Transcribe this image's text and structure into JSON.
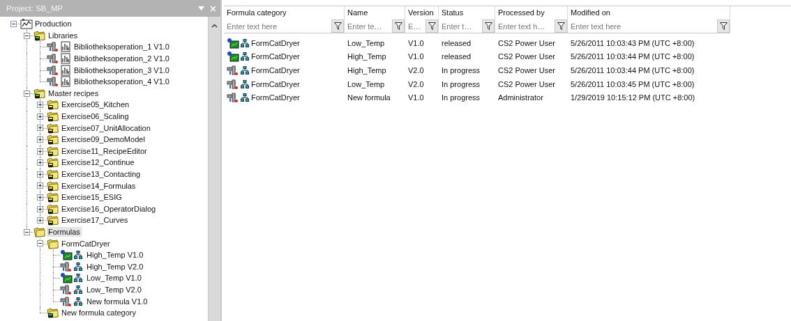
{
  "panel": {
    "title": "Project: SB_MP"
  },
  "tree": [
    {
      "label": "Production",
      "kind": "plant",
      "expanded": true,
      "selected": false,
      "children": [
        {
          "label": "Libraries",
          "kind": "library-folder",
          "expanded": true,
          "selected": false,
          "children": [
            {
              "label": "Bibliotheksoperation_1 V1.0",
              "kind": "library-operation",
              "selected": false
            },
            {
              "label": "Bibliotheksoperation_2 V1.0",
              "kind": "library-operation",
              "selected": false
            },
            {
              "label": "Bibliotheksoperation_3 V1.0",
              "kind": "library-operation",
              "selected": false
            },
            {
              "label": "Bibliotheksoperation_4 V1.0",
              "kind": "library-operation",
              "selected": false
            }
          ]
        },
        {
          "label": "Master recipes",
          "kind": "library-folder",
          "expanded": true,
          "selected": false,
          "children": [
            {
              "label": "Exercise05_Kitchen",
              "kind": "recipe-folder",
              "expanded": false,
              "selected": false
            },
            {
              "label": "Exercise06_Scaling",
              "kind": "recipe-folder",
              "expanded": false,
              "selected": false
            },
            {
              "label": "Exercise07_UnitAllocation",
              "kind": "recipe-folder",
              "expanded": false,
              "selected": false
            },
            {
              "label": "Exercise09_DemoModel",
              "kind": "recipe-folder",
              "expanded": false,
              "selected": false
            },
            {
              "label": "Exercise11_RecipeEditor",
              "kind": "recipe-folder",
              "expanded": false,
              "selected": false
            },
            {
              "label": "Exercise12_Continue",
              "kind": "recipe-folder",
              "expanded": false,
              "selected": false
            },
            {
              "label": "Exercise13_Contacting",
              "kind": "recipe-folder",
              "expanded": false,
              "selected": false
            },
            {
              "label": "Exercise14_Formulas",
              "kind": "recipe-folder",
              "expanded": false,
              "selected": false
            },
            {
              "label": "Exercise15_ESIG",
              "kind": "recipe-folder",
              "expanded": false,
              "selected": false
            },
            {
              "label": "Exercise16_OperatorDialog",
              "kind": "recipe-folder",
              "expanded": false,
              "selected": false
            },
            {
              "label": "Exercise17_Curves",
              "kind": "recipe-folder",
              "expanded": false,
              "selected": false
            }
          ]
        },
        {
          "label": "Formulas",
          "kind": "formula-folder",
          "expanded": true,
          "selected": true,
          "children": [
            {
              "label": "FormCatDryer",
              "kind": "formula-folder",
              "expanded": true,
              "selected": false,
              "children": [
                {
                  "label": "High_Temp V1.0",
                  "kind": "formula-released",
                  "selected": false
                },
                {
                  "label": "High_Temp V2.0",
                  "kind": "formula-draft",
                  "selected": false
                },
                {
                  "label": "Low_Temp V1.0",
                  "kind": "formula-released",
                  "selected": false
                },
                {
                  "label": "Low_Temp V2.0",
                  "kind": "formula-draft",
                  "selected": false
                },
                {
                  "label": "New formula V1.0",
                  "kind": "formula-draft",
                  "selected": false
                }
              ]
            },
            {
              "label": "New formula category",
              "kind": "formula-category",
              "selected": false
            }
          ]
        }
      ]
    }
  ],
  "table": {
    "columns": [
      {
        "label": "Formula category",
        "placeholder": "Enter text here"
      },
      {
        "label": "Name",
        "placeholder": "Enter te…"
      },
      {
        "label": "Version",
        "placeholder": "E…"
      },
      {
        "label": "Status",
        "placeholder": "Enter t…"
      },
      {
        "label": "Processed by",
        "placeholder": "Enter text h…"
      },
      {
        "label": "Modified on",
        "placeholder": "Enter text here"
      }
    ],
    "rows": [
      {
        "kind": "released",
        "cells": [
          "FormCatDryer",
          "Low_Temp",
          "V1.0",
          "released",
          "CS2 Power User",
          "5/26/2011 10:03:43 PM (UTC +8:00)"
        ]
      },
      {
        "kind": "released",
        "cells": [
          "FormCatDryer",
          "High_Temp",
          "V1.0",
          "released",
          "CS2 Power User",
          "5/26/2011 10:03:44 PM (UTC +8:00)"
        ]
      },
      {
        "kind": "draft",
        "cells": [
          "FormCatDryer",
          "High_Temp",
          "V2.0",
          "In progress",
          "CS2 Power User",
          "5/26/2011 10:03:44 PM (UTC +8:00)"
        ]
      },
      {
        "kind": "draft",
        "cells": [
          "FormCatDryer",
          "Low_Temp",
          "V2.0",
          "In progress",
          "CS2 Power User",
          "5/26/2011 10:03:45 PM (UTC +8:00)"
        ]
      },
      {
        "kind": "draft",
        "cells": [
          "FormCatDryer",
          "New formula",
          "V1.0",
          "In progress",
          "Administrator",
          "1/29/2019 10:15:12 PM (UTC +8:00)"
        ]
      }
    ]
  }
}
